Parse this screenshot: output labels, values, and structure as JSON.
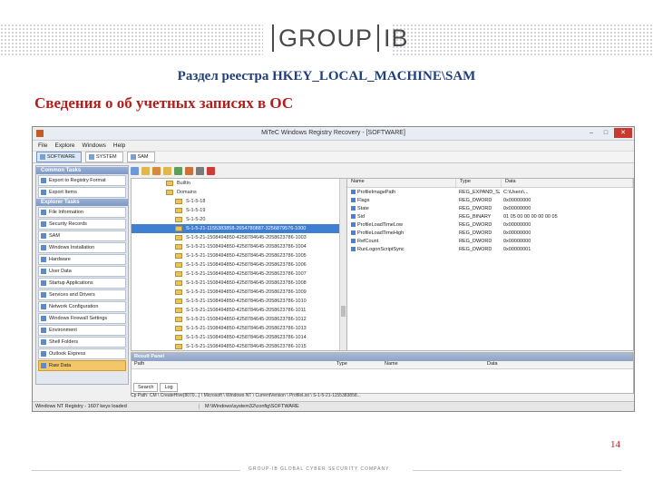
{
  "slide": {
    "logo_left": "GROUP",
    "logo_right": "IB",
    "subtitle": "Раздел реестра HKEY_LOCAL_MACHINE\\SAM",
    "heading": "Сведения о об учетных записях в ОС",
    "page_number": "14",
    "footer": "GROUP-IB GLOBAL CYBER SECURITY COMPANY"
  },
  "window": {
    "title": "MiTeC Windows Registry Recovery - [SOFTWARE]",
    "menu": [
      "File",
      "Explore",
      "Windows",
      "Help"
    ],
    "hives": [
      "SOFTWARE",
      "SYSTEM",
      "SAM"
    ],
    "common_tasks": {
      "header": "Common Tasks",
      "items": [
        "Export to Registry Format",
        "Export Items"
      ]
    },
    "explorer_tasks": {
      "header": "Explorer Tasks",
      "items": [
        "File Information",
        "Security Records",
        "SAM",
        "Windows Installation",
        "Hardware",
        "User Data",
        "Startup Applications",
        "Services and Drivers",
        "Network Configuration",
        "Windows Firewall Settings",
        "Environment",
        "Shell Folders",
        "Outlook Express",
        "Raw Data"
      ]
    },
    "tree": {
      "rows": [
        {
          "label": "Builtin",
          "indent": 1
        },
        {
          "label": "Domains",
          "indent": 1
        },
        {
          "label": "S-1-5-18",
          "indent": 2
        },
        {
          "label": "S-1-5-19",
          "indent": 2
        },
        {
          "label": "S-1-5-20",
          "indent": 2
        },
        {
          "label": "S-1-5-21-1155383858-2654780887-3256879576-1000",
          "indent": 2,
          "selected": true
        },
        {
          "label": "S-1-5-21-1508494850-4258784645-2058623786-1003",
          "indent": 2
        },
        {
          "label": "S-1-5-21-1508494850-4258784645-2058623786-1004",
          "indent": 2
        },
        {
          "label": "S-1-5-21-1508494850-4258784645-2058623786-1005",
          "indent": 2
        },
        {
          "label": "S-1-5-21-1508494850-4258784645-2058623786-1006",
          "indent": 2
        },
        {
          "label": "S-1-5-21-1508494850-4258784645-2058623786-1007",
          "indent": 2
        },
        {
          "label": "S-1-5-21-1508494850-4258784645-2058623786-1008",
          "indent": 2
        },
        {
          "label": "S-1-5-21-1508494850-4258784645-2058623786-1009",
          "indent": 2
        },
        {
          "label": "S-1-5-21-1508494850-4258784645-2058623786-1010",
          "indent": 2
        },
        {
          "label": "S-1-5-21-1508494850-4258784645-2058623786-1011",
          "indent": 2
        },
        {
          "label": "S-1-5-21-1508494850-4258784645-2058623786-1012",
          "indent": 2
        },
        {
          "label": "S-1-5-21-1508494850-4258784645-2058623786-1013",
          "indent": 2
        },
        {
          "label": "S-1-5-21-1508494850-4258784645-2058623786-1014",
          "indent": 2
        },
        {
          "label": "S-1-5-21-1508494850-4258784645-2058623786-1015",
          "indent": 2
        }
      ]
    },
    "values": {
      "headers": [
        "Name",
        "Type",
        "Data"
      ],
      "rows": [
        {
          "name": "ProfileImagePath",
          "type": "REG_EXPAND_SZ",
          "data": "C:\\Users\\..."
        },
        {
          "name": "Flags",
          "type": "REG_DWORD",
          "data": "0x00000000"
        },
        {
          "name": "State",
          "type": "REG_DWORD",
          "data": "0x00000000"
        },
        {
          "name": "Sid",
          "type": "REG_BINARY",
          "data": "01 05 00 00 00 00 00 05"
        },
        {
          "name": "ProfileLoadTimeLow",
          "type": "REG_DWORD",
          "data": "0x00000000"
        },
        {
          "name": "ProfileLoadTimeHigh",
          "type": "REG_DWORD",
          "data": "0x00000000"
        },
        {
          "name": "RefCount",
          "type": "REG_DWORD",
          "data": "0x00000000"
        },
        {
          "name": "RunLogonScriptSync",
          "type": "REG_DWORD",
          "data": "0x00000001"
        }
      ]
    },
    "result_panel": {
      "title": "Result Panel",
      "headers": [
        "Path",
        "Type",
        "Name",
        "Data"
      ],
      "tabs": [
        "Search",
        "Log"
      ]
    },
    "copy_path": "Cp Path: CM \\ CreateHive{8070...} \\ Microsoft \\ Windows NT \\ CurrentVersion \\ ProfileList \\ S-1-5-21-1155383858...",
    "status": {
      "left": "Windows NT Registry - 1607 keys loaded",
      "right": "M:\\Windows\\system32\\config\\SOFTWARE"
    }
  }
}
